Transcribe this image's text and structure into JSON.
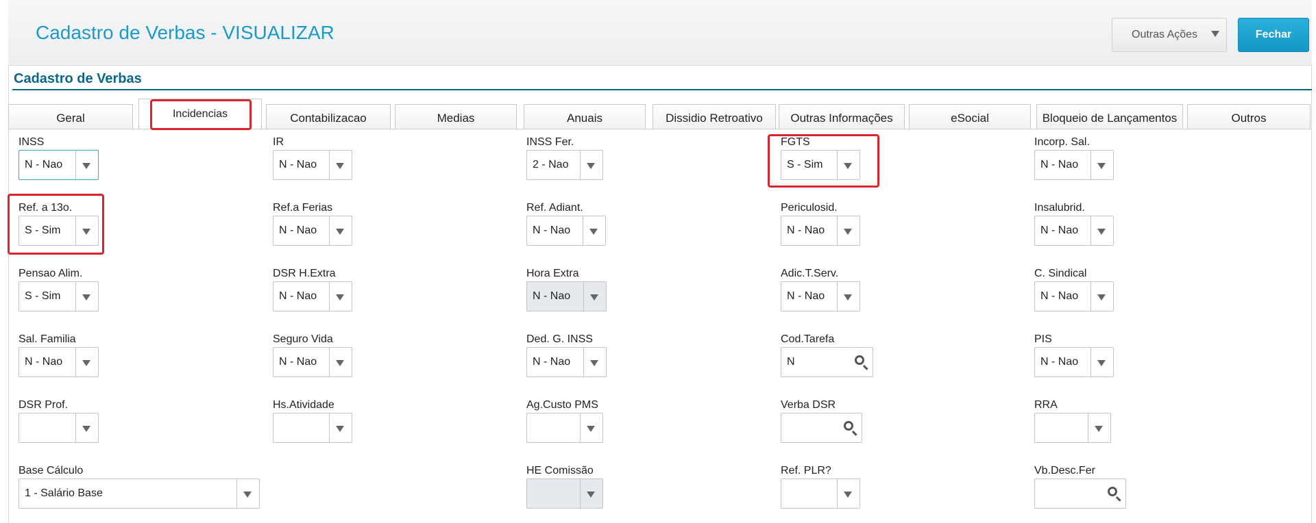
{
  "header": {
    "title": "Cadastro de Verbas - VISUALIZAR",
    "outras_acoes": "Outras Ações",
    "fechar": "Fechar"
  },
  "section": {
    "title": "Cadastro de Verbas"
  },
  "tabs": [
    {
      "label": "Geral"
    },
    {
      "label": "Incidencias"
    },
    {
      "label": "Contabilizacao"
    },
    {
      "label": "Medias"
    },
    {
      "label": "Anuais"
    },
    {
      "label": "Dissidio Retroativo"
    },
    {
      "label": "Outras Informações"
    },
    {
      "label": "eSocial"
    },
    {
      "label": "Bloqueio de Lançamentos"
    },
    {
      "label": "Outros"
    }
  ],
  "active_tab": "Incidencias",
  "highlight_color": "#d9252c",
  "fields": {
    "inss": {
      "label": "INSS",
      "value": "N - Nao"
    },
    "ir": {
      "label": "IR",
      "value": "N - Nao"
    },
    "inss_fer": {
      "label": "INSS Fer.",
      "value": "2 - Nao"
    },
    "fgts": {
      "label": "FGTS",
      "value": "S - Sim"
    },
    "incorp_sal": {
      "label": "Incorp. Sal.",
      "value": "N - Nao"
    },
    "ref_13": {
      "label": "Ref. a 13o.",
      "value": "S - Sim"
    },
    "ref_ferias": {
      "label": "Ref.a Ferias",
      "value": "N - Nao"
    },
    "ref_adiant": {
      "label": "Ref. Adiant.",
      "value": "N - Nao"
    },
    "periculosid": {
      "label": "Periculosid.",
      "value": "N - Nao"
    },
    "insalubrid": {
      "label": "Insalubrid.",
      "value": "N - Nao"
    },
    "pensao_alim": {
      "label": "Pensao Alim.",
      "value": "S - Sim"
    },
    "dsr_hextra": {
      "label": "DSR H.Extra",
      "value": "N - Nao"
    },
    "hora_extra": {
      "label": "Hora Extra",
      "value": "N - Nao"
    },
    "adic_tserv": {
      "label": "Adic.T.Serv.",
      "value": "N - Nao"
    },
    "c_sindical": {
      "label": "C. Sindical",
      "value": "N - Nao"
    },
    "sal_familia": {
      "label": "Sal. Familia",
      "value": "N - Nao"
    },
    "seguro_vida": {
      "label": "Seguro Vida",
      "value": "N - Nao"
    },
    "ded_g_inss": {
      "label": "Ded. G. INSS",
      "value": "N - Nao"
    },
    "cod_tarefa": {
      "label": "Cod.Tarefa",
      "value": "N"
    },
    "pis": {
      "label": "PIS",
      "value": "N - Nao"
    },
    "dsr_prof": {
      "label": "DSR Prof.",
      "value": ""
    },
    "hs_atividade": {
      "label": "Hs.Atividade",
      "value": ""
    },
    "ag_custo_pms": {
      "label": "Ag.Custo PMS",
      "value": ""
    },
    "verba_dsr": {
      "label": "Verba DSR",
      "value": ""
    },
    "rra": {
      "label": "RRA",
      "value": ""
    },
    "base_calculo": {
      "label": "Base Cálculo",
      "value": "1 - Salário Base"
    },
    "he_comissao": {
      "label": "HE Comissão",
      "value": ""
    },
    "ref_plr": {
      "label": "Ref. PLR?",
      "value": ""
    },
    "vb_desc_fer": {
      "label": "Vb.Desc.Fer",
      "value": ""
    }
  }
}
